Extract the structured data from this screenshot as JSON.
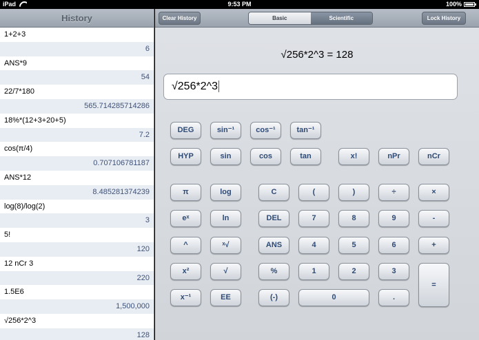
{
  "status": {
    "device": "iPad",
    "time": "9:53 PM",
    "battery": "100%"
  },
  "history": {
    "title": "History",
    "entries": [
      {
        "expr": "1+2+3",
        "result": "6"
      },
      {
        "expr": "ANS*9",
        "result": "54"
      },
      {
        "expr": "22/7*180",
        "result": "565.714285714286"
      },
      {
        "expr": "18%*(12+3+20+5)",
        "result": "7.2"
      },
      {
        "expr": "cos(π/4)",
        "result": "0.707106781187"
      },
      {
        "expr": "ANS*12",
        "result": "8.485281374239"
      },
      {
        "expr": "log(8)/log(2)",
        "result": "3"
      },
      {
        "expr": "5!",
        "result": "120"
      },
      {
        "expr": "12 nCr 3",
        "result": "220"
      },
      {
        "expr": "1.5E6",
        "result": "1,500,000"
      },
      {
        "expr": "√256*2^3",
        "result": "128"
      }
    ]
  },
  "toolbar": {
    "clear_history": "Clear History",
    "mode_basic": "Basic",
    "mode_scientific": "Scientific",
    "lock_history": "Lock History",
    "selected_mode": "Scientific"
  },
  "display": {
    "result_line": "√256*2^3 = 128",
    "input_value": "√256*2^3"
  },
  "keys": {
    "deg": "DEG",
    "asin": "sin⁻¹",
    "acos": "cos⁻¹",
    "atan": "tan⁻¹",
    "hyp": "HYP",
    "sin": "sin",
    "cos": "cos",
    "tan": "tan",
    "fact": "x!",
    "npr": "nPr",
    "ncr": "nCr",
    "pi": "π",
    "log": "log",
    "clear": "C",
    "lparen": "(",
    "rparen": ")",
    "divide": "÷",
    "multiply": "×",
    "exp": "eˣ",
    "ln": "ln",
    "del": "DEL",
    "seven": "7",
    "eight": "8",
    "nine": "9",
    "minus": "-",
    "power": "^",
    "root_n": "ˣ√",
    "ans": "ANS",
    "four": "4",
    "five": "5",
    "six": "6",
    "plus": "+",
    "square": "x²",
    "sqrt": "√",
    "percent": "%",
    "one": "1",
    "two": "2",
    "three": "3",
    "equals": "=",
    "inverse": "x⁻¹",
    "ee": "EE",
    "negate": "(-)",
    "zero": "0",
    "decimal": "."
  }
}
